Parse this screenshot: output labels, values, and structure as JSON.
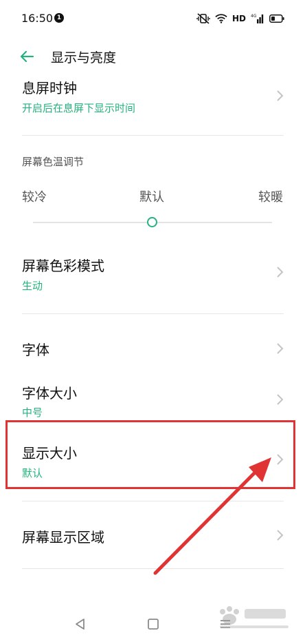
{
  "status_bar": {
    "time": "16:50",
    "notification_count": "1",
    "hd": "HD"
  },
  "header": {
    "title": "显示与亮度"
  },
  "rows": {
    "aod_clock": {
      "title": "息屏时钟",
      "subtitle": "开启后在息屏下显示时间"
    },
    "color_temp": {
      "label": "屏幕色温调节",
      "cool": "较冷",
      "default": "默认",
      "warm": "较暖",
      "value": 0.5
    },
    "color_mode": {
      "title": "屏幕色彩模式",
      "subtitle": "生动"
    },
    "font": {
      "title": "字体"
    },
    "font_size": {
      "title": "字体大小",
      "subtitle": "中号"
    },
    "display_size": {
      "title": "显示大小",
      "subtitle": "默认"
    },
    "display_area": {
      "title": "屏幕显示区域"
    }
  },
  "colors": {
    "accent": "#25b37d",
    "annotation": "#e03434"
  },
  "icons": {
    "back": "arrow-left-icon",
    "chevron": "chevron-right-icon",
    "nav_back": "triangle-back-icon",
    "nav_home": "square-home-icon",
    "nav_menu": "menu-icon"
  }
}
